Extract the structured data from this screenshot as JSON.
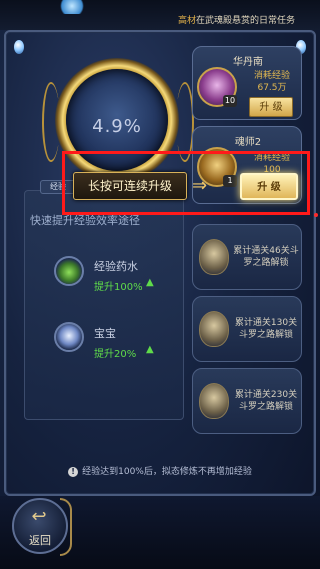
{
  "top_bar": {
    "ticker_highlight": "高材",
    "ticker_text": "在武魂殿悬赏的日常任务"
  },
  "main": {
    "exp_percent": "4.9%",
    "tab_label": "经验",
    "section_title": "快速提升经验效率途径",
    "items": [
      {
        "name": "经验药水",
        "gain": "提升100%"
      },
      {
        "name": "宝宝",
        "gain": "提升20%"
      }
    ]
  },
  "cards": [
    {
      "title": "华丹南",
      "sub1": "消耗经验",
      "sub2": "67.5万",
      "badge": "10",
      "button": "升 级"
    },
    {
      "title": "魂师2",
      "sub1": "消耗经验",
      "sub2": "100",
      "badge": "1",
      "button": "升 级"
    }
  ],
  "locked": [
    {
      "text": "累计通关46关斗罗之路解锁"
    },
    {
      "text": "累计通关130关斗罗之路解锁"
    },
    {
      "text": "累计通关230关斗罗之路解锁"
    }
  ],
  "tooltip": {
    "hint": "长按可连续升级",
    "arrow": "⇒",
    "button": "升 级"
  },
  "footer": {
    "note": "经验达到100%后，拟态修炼不再增加经验",
    "back_label": "返回",
    "back_glyph": "↩"
  }
}
